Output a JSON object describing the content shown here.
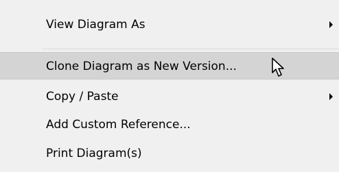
{
  "context_menu": {
    "items": [
      {
        "label": "View Diagram As",
        "has_submenu": true
      },
      {
        "label": "Clone Diagram as New Version...",
        "highlighted": true
      },
      {
        "label": "Copy / Paste",
        "has_submenu": true
      },
      {
        "label": "Add Custom Reference..."
      },
      {
        "label": "Print Diagram(s)"
      }
    ]
  },
  "colors": {
    "menu_background": "#f0f0f0",
    "highlight_background": "#d4d4d4",
    "text": "#000000"
  },
  "icons": {
    "submenu": "triangle-right",
    "cursor": "mouse-pointer-arrow"
  }
}
